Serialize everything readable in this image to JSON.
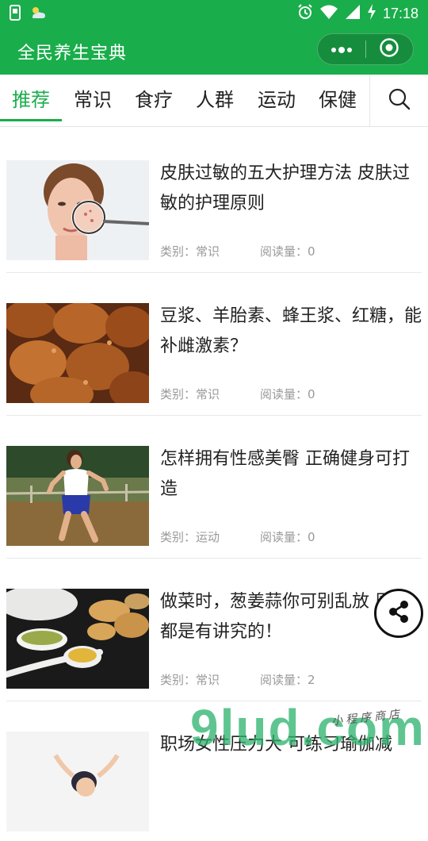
{
  "status_bar": {
    "time": "17:18",
    "icons": [
      "sim-icon",
      "weather-icon",
      "alarm-icon",
      "wifi-icon",
      "signal-icon",
      "charging-icon"
    ]
  },
  "app": {
    "title": "全民养生宝典",
    "brand_color": "#1aad4b"
  },
  "tabs": [
    {
      "label": "推荐",
      "active": true
    },
    {
      "label": "常识",
      "active": false
    },
    {
      "label": "食疗",
      "active": false
    },
    {
      "label": "人群",
      "active": false
    },
    {
      "label": "运动",
      "active": false
    },
    {
      "label": "保健",
      "active": false
    }
  ],
  "articles": [
    {
      "title": "皮肤过敏的五大护理方法 皮肤过敏的护理原则",
      "category": "类别：常识",
      "reads": "阅读量：0"
    },
    {
      "title": "豆浆、羊胎素、蜂王浆、红糖，能补雌激素？",
      "category": "类别：常识",
      "reads": "阅读量：0"
    },
    {
      "title": "怎样拥有性感美臀 正确健身可打造",
      "category": "类别：运动",
      "reads": "阅读量：0"
    },
    {
      "title": "做菜时，葱姜蒜你可别乱放 原来都是有讲究的！",
      "category": "类别：常识",
      "reads": "阅读量：2"
    },
    {
      "title": "职场女性压力大 可练习瑜伽减",
      "category": "",
      "reads": ""
    }
  ],
  "watermark": {
    "big": "9lud.com",
    "small": "小程序商店"
  }
}
